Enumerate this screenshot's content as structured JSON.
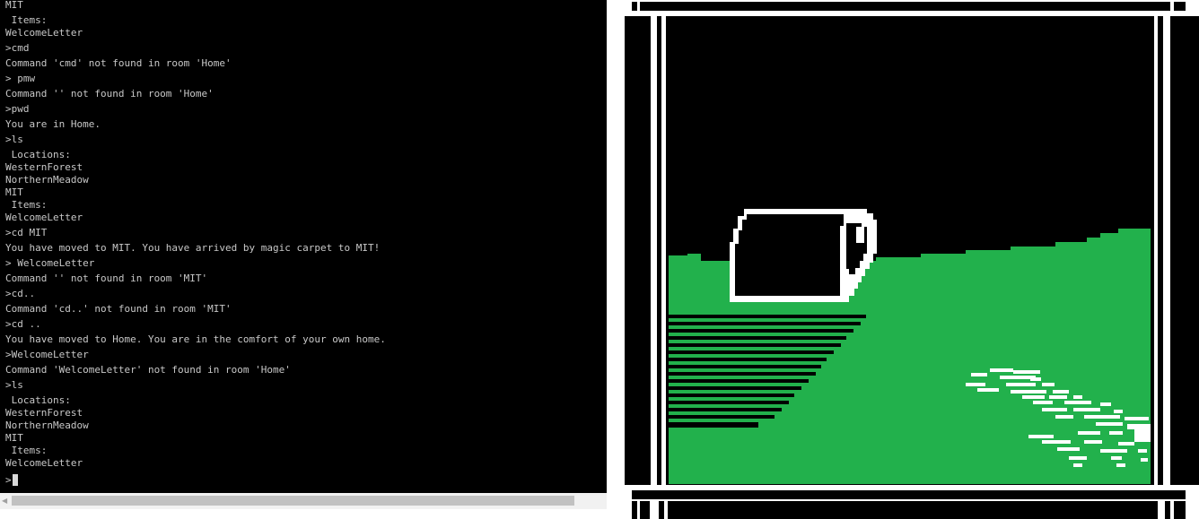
{
  "terminal": {
    "lines": [
      {
        "text": "MIT",
        "kind": "output"
      },
      {
        "text": " Items:",
        "kind": "sub"
      },
      {
        "text": "WelcomeLetter",
        "kind": "output"
      },
      {
        "text": ">cmd",
        "kind": "input"
      },
      {
        "text": "Command 'cmd' not found in room 'Home'",
        "kind": "output"
      },
      {
        "text": "> pmw",
        "kind": "input"
      },
      {
        "text": "Command '' not found in room 'Home'",
        "kind": "output"
      },
      {
        "text": ">pwd",
        "kind": "input"
      },
      {
        "text": "You are in Home.",
        "kind": "output"
      },
      {
        "text": ">ls",
        "kind": "input"
      },
      {
        "text": " Locations:",
        "kind": "sub"
      },
      {
        "text": "WesternForest",
        "kind": "sub"
      },
      {
        "text": "NorthernMeadow",
        "kind": "sub"
      },
      {
        "text": "MIT",
        "kind": "sub"
      },
      {
        "text": " Items:",
        "kind": "sub"
      },
      {
        "text": "WelcomeLetter",
        "kind": "output"
      },
      {
        "text": ">cd MIT",
        "kind": "input"
      },
      {
        "text": "You have moved to MIT. You have arrived by magic carpet to MIT!",
        "kind": "output"
      },
      {
        "text": "> WelcomeLetter",
        "kind": "input"
      },
      {
        "text": "Command '' not found in room 'MIT'",
        "kind": "output"
      },
      {
        "text": ">cd..",
        "kind": "input"
      },
      {
        "text": "Command 'cd..' not found in room 'MIT'",
        "kind": "output"
      },
      {
        "text": ">cd ..",
        "kind": "input"
      },
      {
        "text": "You have moved to Home. You are in the comfort of your own home.",
        "kind": "output"
      },
      {
        "text": ">WelcomeLetter",
        "kind": "input"
      },
      {
        "text": "Command 'WelcomeLetter' not found in room 'Home'",
        "kind": "output"
      },
      {
        "text": ">ls",
        "kind": "input"
      },
      {
        "text": " Locations:",
        "kind": "sub"
      },
      {
        "text": "WesternForest",
        "kind": "sub"
      },
      {
        "text": "NorthernMeadow",
        "kind": "sub"
      },
      {
        "text": "MIT",
        "kind": "sub"
      },
      {
        "text": " Items:",
        "kind": "sub"
      },
      {
        "text": "WelcomeLetter",
        "kind": "output"
      }
    ],
    "prompt": ">",
    "colors": {
      "background": "#000000",
      "text": "#c8c8c8"
    }
  },
  "scrollbar": {
    "left_arrow_icon": "arrow-left-icon",
    "left_arrow_glyph": "◀"
  },
  "scene": {
    "colors": {
      "sky": "#000000",
      "grass": "#22b14c",
      "frame": "#ffffff",
      "outline": "#ffffff"
    }
  }
}
